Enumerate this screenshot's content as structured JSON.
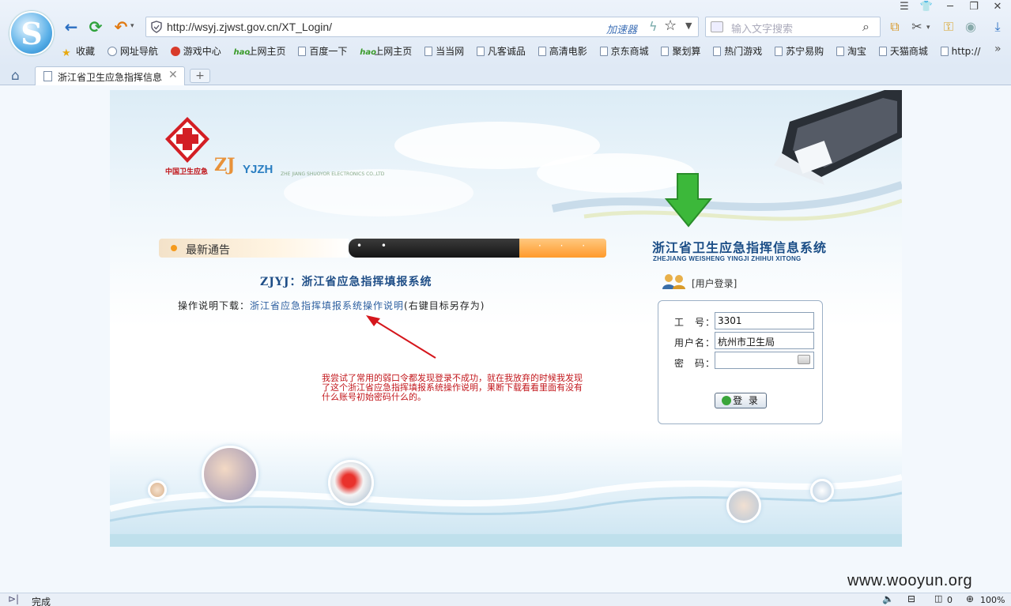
{
  "browser": {
    "url": "http://wsyj.zjwst.gov.cn/XT_Login/",
    "accelerator": "加速器",
    "search_placeholder": "输入文字搜索",
    "bookmarks": [
      {
        "label": "收藏",
        "icon": "star-icon"
      },
      {
        "label": "网址导航",
        "icon": "globe-icon"
      },
      {
        "label": "游戏中心",
        "icon": "game-icon"
      },
      {
        "label": "上网主页",
        "icon": "hao-icon"
      },
      {
        "label": "百度一下",
        "icon": "page-icon"
      },
      {
        "label": "上网主页",
        "icon": "hao-icon"
      },
      {
        "label": "当当网",
        "icon": "page-icon"
      },
      {
        "label": "凡客诚品",
        "icon": "page-icon"
      },
      {
        "label": "高清电影",
        "icon": "page-icon"
      },
      {
        "label": "京东商城",
        "icon": "page-icon"
      },
      {
        "label": "聚划算",
        "icon": "page-icon"
      },
      {
        "label": "热门游戏",
        "icon": "page-icon"
      },
      {
        "label": "苏宁易购",
        "icon": "page-icon"
      },
      {
        "label": "淘宝",
        "icon": "page-icon"
      },
      {
        "label": "天猫商城",
        "icon": "page-icon"
      },
      {
        "label": "http://",
        "icon": "page-icon"
      }
    ],
    "more": "»",
    "tab_title": "浙江省卫生应急指挥信息",
    "new_tab": "+",
    "status_text": "完成",
    "status_count": "0",
    "zoom": "100%"
  },
  "page": {
    "logo_cn": "中国卫生应急",
    "logo_zj": "ZJ",
    "logo_yjzh": "YJZH",
    "logo_sub": "ZHE JIANG SHUOYOR ELECTRONICS CO.,LTD",
    "notice_title": "最新通告",
    "notice_dots_dark": "• •",
    "notice_dots_orange": "· · ·",
    "system_heading": "ZJYJ：浙江省应急指挥填报系统",
    "manual_prefix": "操作说明下载：",
    "manual_link": "浙江省应急指挥填报系统操作说明",
    "manual_suffix": "(右键目标另存为)",
    "annotation": "我尝试了常用的弱口令都发现登录不成功，就在我放弃的时候我发现了这个浙江省应急指挥填报系统操作说明，果断下载看看里面有没有什么账号初始密码什么的。"
  },
  "login": {
    "title": "浙江省卫生应急指挥信息系统",
    "subtitle": "ZHEJIANG WEISHENG YINGJI ZHIHUI XITONG",
    "user_login": "[用户登录]",
    "id_label": "工　号：",
    "id_value": "3301",
    "name_label": "用户名：",
    "name_value": "杭州市卫生局",
    "pwd_label": "密　码：",
    "pwd_value": "",
    "button": "登 录"
  },
  "watermark": "www.wooyun.org",
  "colors": {
    "title_blue": "#1a4d86",
    "annotation_red": "#c2161b",
    "notice_orange": "#ff9a2a"
  }
}
